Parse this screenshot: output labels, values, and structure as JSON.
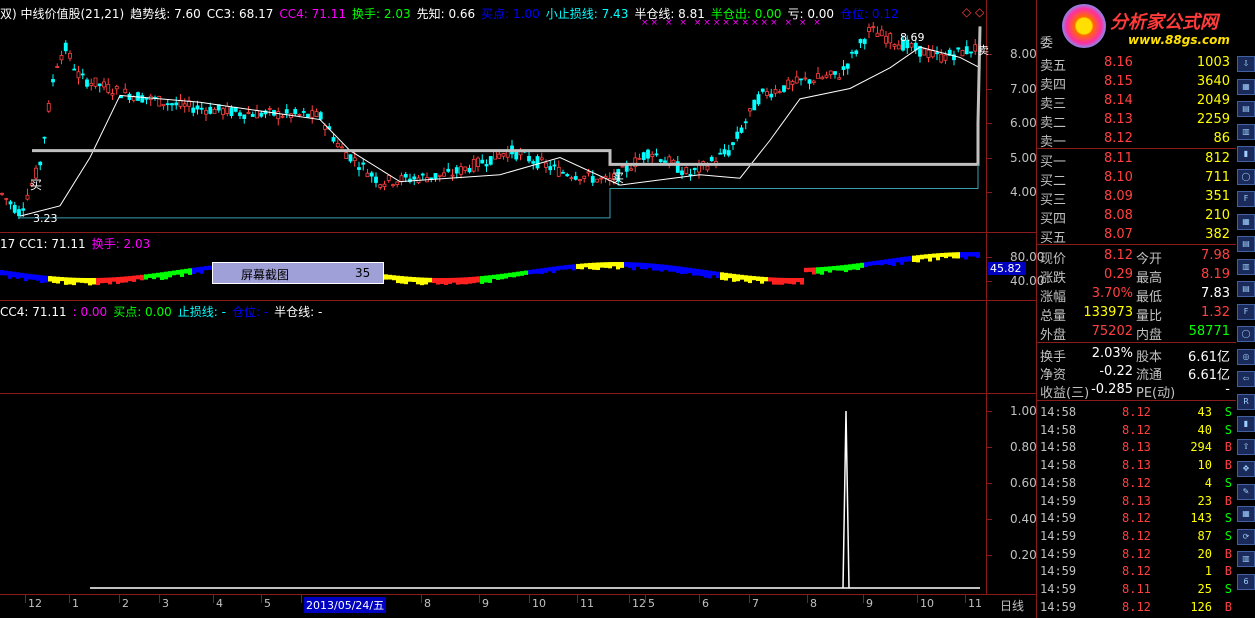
{
  "main_panel": {
    "legend": [
      {
        "text": "双) 中线价值股(21,21)",
        "color": "#ffffff"
      },
      {
        "text": "趋势线: 7.60",
        "color": "#ffffff"
      },
      {
        "text": "CC3: 68.17",
        "color": "#ffffff"
      },
      {
        "text": "CC4: 71.11",
        "color": "#ff00ff"
      },
      {
        "text": "换手: 2.03",
        "color": "#00ff00"
      },
      {
        "text": "先知: 0.66",
        "color": "#ffffff"
      },
      {
        "text": "买点: 1.00",
        "color": "#0000ff"
      },
      {
        "text": "小止损线: 7.43",
        "color": "#00ffff"
      },
      {
        "text": "半仓线: 8.81",
        "color": "#ffffff"
      },
      {
        "text": "半仓出: 0.00",
        "color": "#00ff00"
      },
      {
        "text": "亏: 0.00",
        "color": "#ffffff"
      },
      {
        "text": "仓位: 0.12",
        "color": "#0000ff"
      }
    ],
    "y_ticks": [
      "8.00",
      "7.00",
      "6.00",
      "5.00",
      "4.00"
    ],
    "annotations": {
      "low": "3.23",
      "high": "8.69",
      "buy_left": "买",
      "buy_mid": "买",
      "sell_right": "卖"
    },
    "sell_markers": "×× × × ××××××××× × × ×"
  },
  "panel2": {
    "legend": [
      {
        "text": "17  CC1: 71.11",
        "color": "#ffffff"
      },
      {
        "text": "换手: 2.03",
        "color": "#ff00ff"
      }
    ],
    "y_ticks": [
      "80.00",
      "40.00"
    ],
    "current_value": "45.82",
    "tooltip": {
      "label": "屏幕截图",
      "value": "35"
    }
  },
  "panel3": {
    "legend": [
      {
        "text": "CC4: 71.11",
        "color": "#ffffff"
      },
      {
        "text": ": 0.00",
        "color": "#ff00ff"
      },
      {
        "text": "买点: 0.00",
        "color": "#00ff00"
      },
      {
        "text": "止损线: -",
        "color": "#00ffff"
      },
      {
        "text": "仓位: -",
        "color": "#0000ff"
      },
      {
        "text": "半仓线: -",
        "color": "#ffffff"
      }
    ]
  },
  "panel4": {
    "y_ticks": [
      "1.00",
      "0.80",
      "0.60",
      "0.40",
      "0.20"
    ]
  },
  "date_axis": {
    "labels": [
      "12",
      "1",
      "2",
      "3",
      "4",
      "5",
      "2013/05/24/五",
      "8",
      "9",
      "10",
      "11",
      "12",
      "5",
      "6",
      "7",
      "8",
      "9",
      "10",
      "11"
    ],
    "period_label": "日线"
  },
  "logo": {
    "title": "分析家公式网",
    "url": "www.88gs.com"
  },
  "order_book": {
    "header": "委",
    "asks": [
      {
        "label": "卖五",
        "price": "8.16",
        "vol": "1003"
      },
      {
        "label": "卖四",
        "price": "8.15",
        "vol": "3640"
      },
      {
        "label": "卖三",
        "price": "8.14",
        "vol": "2049"
      },
      {
        "label": "卖二",
        "price": "8.13",
        "vol": "2259"
      },
      {
        "label": "卖一",
        "price": "8.12",
        "vol": "86"
      }
    ],
    "bids": [
      {
        "label": "买一",
        "price": "8.11",
        "vol": "812"
      },
      {
        "label": "买二",
        "price": "8.10",
        "vol": "711"
      },
      {
        "label": "买三",
        "price": "8.09",
        "vol": "351"
      },
      {
        "label": "买四",
        "price": "8.08",
        "vol": "210"
      },
      {
        "label": "买五",
        "price": "8.07",
        "vol": "382"
      }
    ]
  },
  "quote": {
    "rows": [
      {
        "l1": "现价",
        "v1": "8.12",
        "c1": "#ff4040",
        "l2": "今开",
        "v2": "7.98",
        "c2": "#ff4040"
      },
      {
        "l1": "涨跌",
        "v1": "0.29",
        "c1": "#ff4040",
        "l2": "最高",
        "v2": "8.19",
        "c2": "#ff4040"
      },
      {
        "l1": "涨幅",
        "v1": "3.70%",
        "c1": "#ff4040",
        "l2": "最低",
        "v2": "7.83",
        "c2": "#ffffff"
      },
      {
        "l1": "总量",
        "v1": "133973",
        "c1": "#ffff00",
        "l2": "量比",
        "v2": "1.32",
        "c2": "#ff4040"
      },
      {
        "l1": "外盘",
        "v1": "75202",
        "c1": "#ff4040",
        "l2": "内盘",
        "v2": "58771",
        "c2": "#00ff00"
      }
    ],
    "rows2": [
      {
        "l1": "换手",
        "v1": "2.03%",
        "l2": "股本",
        "v2": "6.61亿"
      },
      {
        "l1": "净资",
        "v1": "-0.22",
        "l2": "流通",
        "v2": "6.61亿"
      },
      {
        "l1": "收益(三)",
        "v1": "-0.285",
        "l2": "PE(动)",
        "v2": "-"
      }
    ]
  },
  "ticks": [
    {
      "time": "14:58",
      "price": "8.12",
      "vol": "43",
      "side": "S"
    },
    {
      "time": "14:58",
      "price": "8.12",
      "vol": "40",
      "side": "S"
    },
    {
      "time": "14:58",
      "price": "8.13",
      "vol": "294",
      "side": "B"
    },
    {
      "time": "14:58",
      "price": "8.13",
      "vol": "10",
      "side": "B"
    },
    {
      "time": "14:58",
      "price": "8.12",
      "vol": "4",
      "side": "S"
    },
    {
      "time": "14:59",
      "price": "8.13",
      "vol": "23",
      "side": "B"
    },
    {
      "time": "14:59",
      "price": "8.12",
      "vol": "143",
      "side": "S"
    },
    {
      "time": "14:59",
      "price": "8.12",
      "vol": "87",
      "side": "S"
    },
    {
      "time": "14:59",
      "price": "8.12",
      "vol": "20",
      "side": "B"
    },
    {
      "time": "14:59",
      "price": "8.12",
      "vol": "1",
      "side": "B"
    },
    {
      "time": "14:59",
      "price": "8.11",
      "vol": "25",
      "side": "S"
    },
    {
      "time": "14:59",
      "price": "8.12",
      "vol": "126",
      "side": "B"
    }
  ],
  "toolbar_icons": [
    "arrow-down",
    "grid",
    "table",
    "chart",
    "candle",
    "circle-70",
    "fin",
    "grid2",
    "table2",
    "chart2",
    "table3",
    "fiz",
    "circle2",
    "ring",
    "arrow-left",
    "rsi",
    "bar",
    "arrow-up",
    "move",
    "pencil",
    "grid3",
    "refresh",
    "chart3",
    "num-60"
  ],
  "colors": {
    "up": "#ff4040",
    "down": "#00ffff",
    "grid": "#8b1a1a",
    "bg": "#000000"
  }
}
